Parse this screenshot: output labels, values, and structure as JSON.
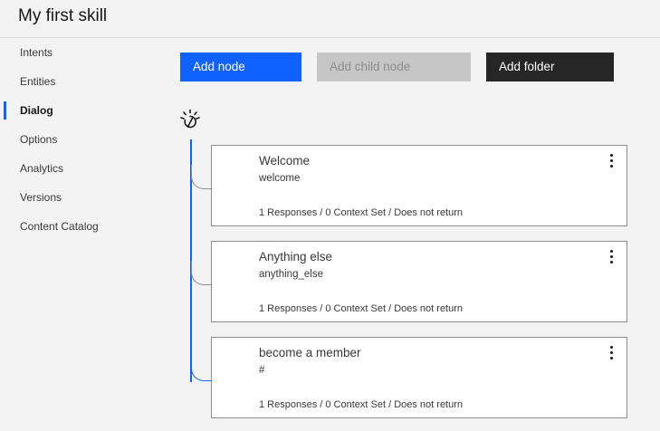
{
  "header": {
    "title": "My first skill"
  },
  "sidebar": {
    "items": [
      {
        "label": "Intents"
      },
      {
        "label": "Entities"
      },
      {
        "label": "Dialog",
        "active": true
      },
      {
        "label": "Options"
      },
      {
        "label": "Analytics"
      },
      {
        "label": "Versions"
      },
      {
        "label": "Content Catalog"
      }
    ]
  },
  "toolbar": {
    "add_node_label": "Add node",
    "add_child_node_label": "Add child node",
    "add_folder_label": "Add folder"
  },
  "root": {
    "icon": "watson-icon"
  },
  "nodes": [
    {
      "title": "Welcome",
      "condition": "welcome",
      "summary": "1 Responses / 0 Context Set / Does not return"
    },
    {
      "title": "Anything else",
      "condition": "anything_else",
      "summary": "1 Responses / 0 Context Set / Does not return"
    },
    {
      "title": "become a member",
      "condition": "#",
      "summary": "1 Responses / 0 Context Set / Does not return"
    }
  ],
  "colors": {
    "accent": "#0f62fe",
    "disabled": "#c6c6c6",
    "dark": "#262626",
    "background": "#f3f3f3"
  }
}
